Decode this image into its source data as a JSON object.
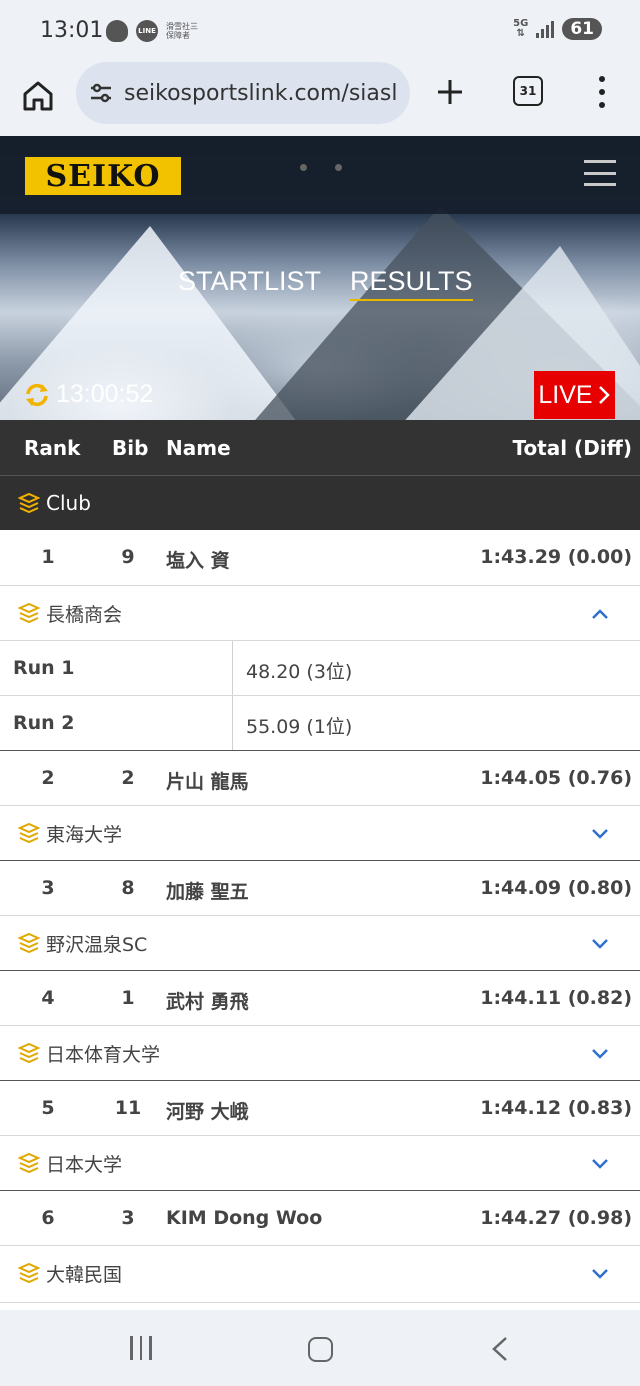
{
  "status_bar": {
    "time": "13:01",
    "line_label": "LINE",
    "notif_text_1": "滑雪社三",
    "notif_text_2": "保障者",
    "network": "5G",
    "battery": "61"
  },
  "browser": {
    "url": "seikosportslink.com/siasl",
    "tab_count": "31"
  },
  "header": {
    "logo_text": "SEIKO",
    "tabs": [
      {
        "label": "STARTLIST",
        "active": false
      },
      {
        "label": "RESULTS",
        "active": true
      }
    ],
    "clock": "13:00:52",
    "live_label": "LIVE"
  },
  "table": {
    "columns": {
      "rank": "Rank",
      "bib": "Bib",
      "name": "Name",
      "total": "Total (Diff)"
    },
    "group_label": "Club",
    "rows": [
      {
        "rank": "1",
        "bib": "9",
        "name": "塩入 資",
        "total": "1:43.29 (0.00)",
        "club": "長橋商会",
        "expanded": true,
        "runs": [
          {
            "label": "Run 1",
            "value": "48.20 (3位)"
          },
          {
            "label": "Run 2",
            "value": "55.09 (1位)"
          }
        ]
      },
      {
        "rank": "2",
        "bib": "2",
        "name": "片山 龍馬",
        "total": "1:44.05 (0.76)",
        "club": "東海大学",
        "expanded": false
      },
      {
        "rank": "3",
        "bib": "8",
        "name": "加藤 聖五",
        "total": "1:44.09 (0.80)",
        "club": "野沢温泉SC",
        "expanded": false
      },
      {
        "rank": "4",
        "bib": "1",
        "name": "武村 勇飛",
        "total": "1:44.11 (0.82)",
        "club": "日本体育大学",
        "expanded": false
      },
      {
        "rank": "5",
        "bib": "11",
        "name": "河野 大峨",
        "total": "1:44.12 (0.83)",
        "club": "日本大学",
        "expanded": false
      },
      {
        "rank": "6",
        "bib": "3",
        "name": "KIM Dong Woo",
        "total": "1:44.27 (0.98)",
        "club": "大韓民国",
        "expanded": false
      }
    ]
  },
  "colors": {
    "accent_gold": "#e8b800",
    "live_red": "#e60000",
    "chevron_blue": "#2f6fcf"
  },
  "icons": [
    "home-icon",
    "site-settings-icon",
    "plus-icon",
    "tabs-icon",
    "more-icon",
    "hamburger-icon",
    "refresh-icon",
    "chevron-right-icon",
    "layers-icon",
    "chevron-up-icon",
    "chevron-down-icon"
  ]
}
